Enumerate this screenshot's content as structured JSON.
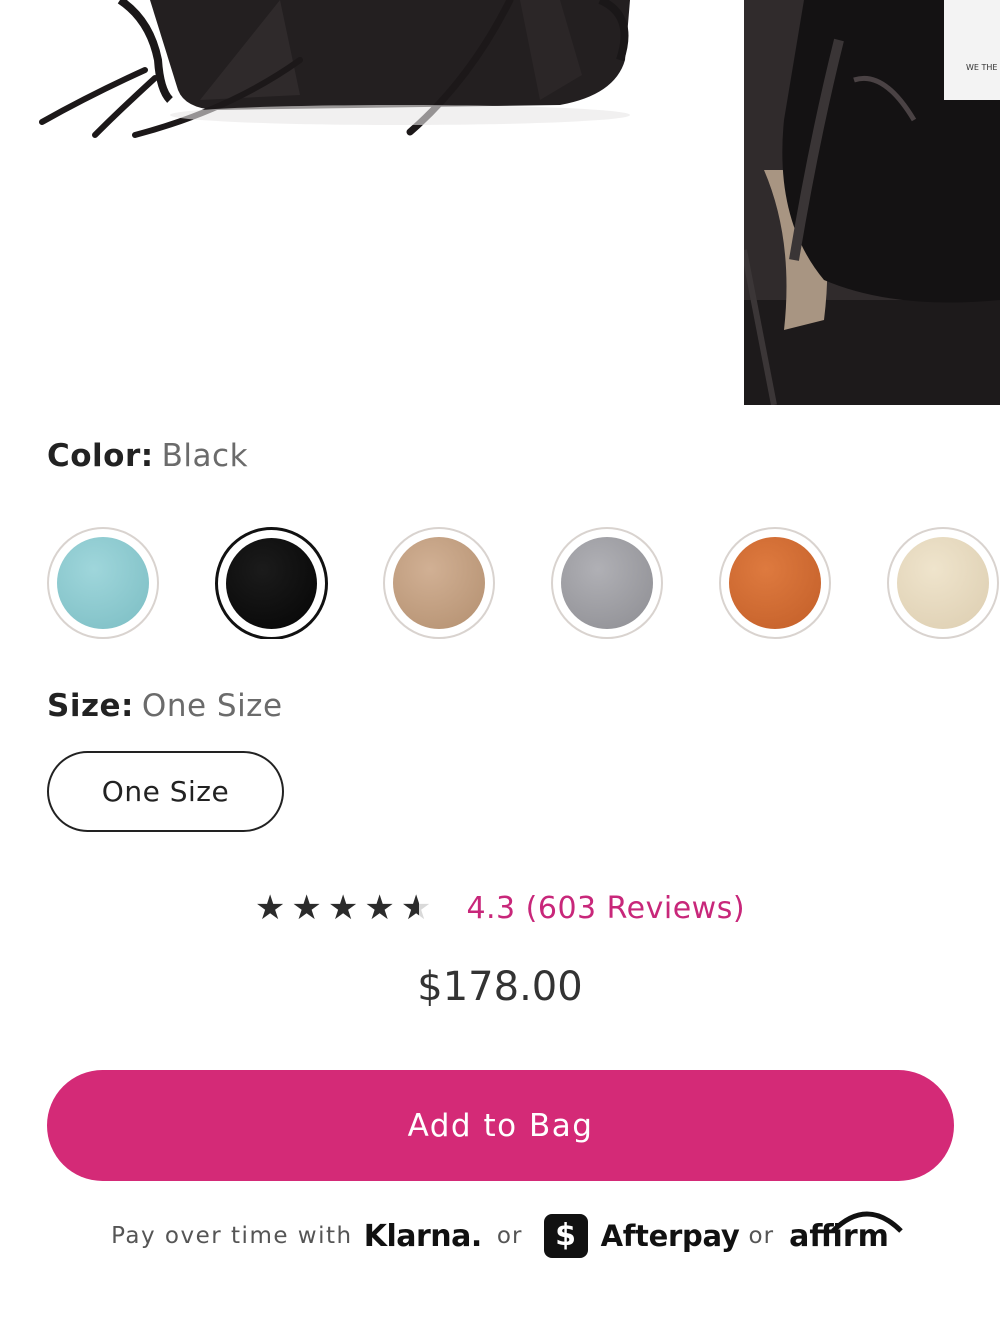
{
  "product": {
    "color_label": "Color:",
    "color_value": "Black",
    "swatches": [
      {
        "name": "turquoise",
        "color": "#87c6cc"
      },
      {
        "name": "black",
        "color": "#0d0d0d",
        "selected": true
      },
      {
        "name": "tan",
        "color": "#c29f7f"
      },
      {
        "name": "grey",
        "color": "#9c9ca1"
      },
      {
        "name": "orange",
        "color": "#cf6a31"
      },
      {
        "name": "cream",
        "color": "#e6d9bf"
      }
    ],
    "size_label": "Size:",
    "size_value": "One Size",
    "size_option": "One Size",
    "rating": {
      "stars": 4.3,
      "text": "4.3 (603 Reviews)"
    },
    "price": "$178.00",
    "add_to_bag": "Add to Bag"
  },
  "payment": {
    "prefix": "Pay over time with",
    "klarna": "Klarna.",
    "or1": "or",
    "afterpay_icon": "$",
    "afterpay": "Afterpay",
    "or2": "or",
    "affirm": "affirm"
  },
  "colors": {
    "accent": "#d42a77",
    "review_link": "#c8277a"
  }
}
